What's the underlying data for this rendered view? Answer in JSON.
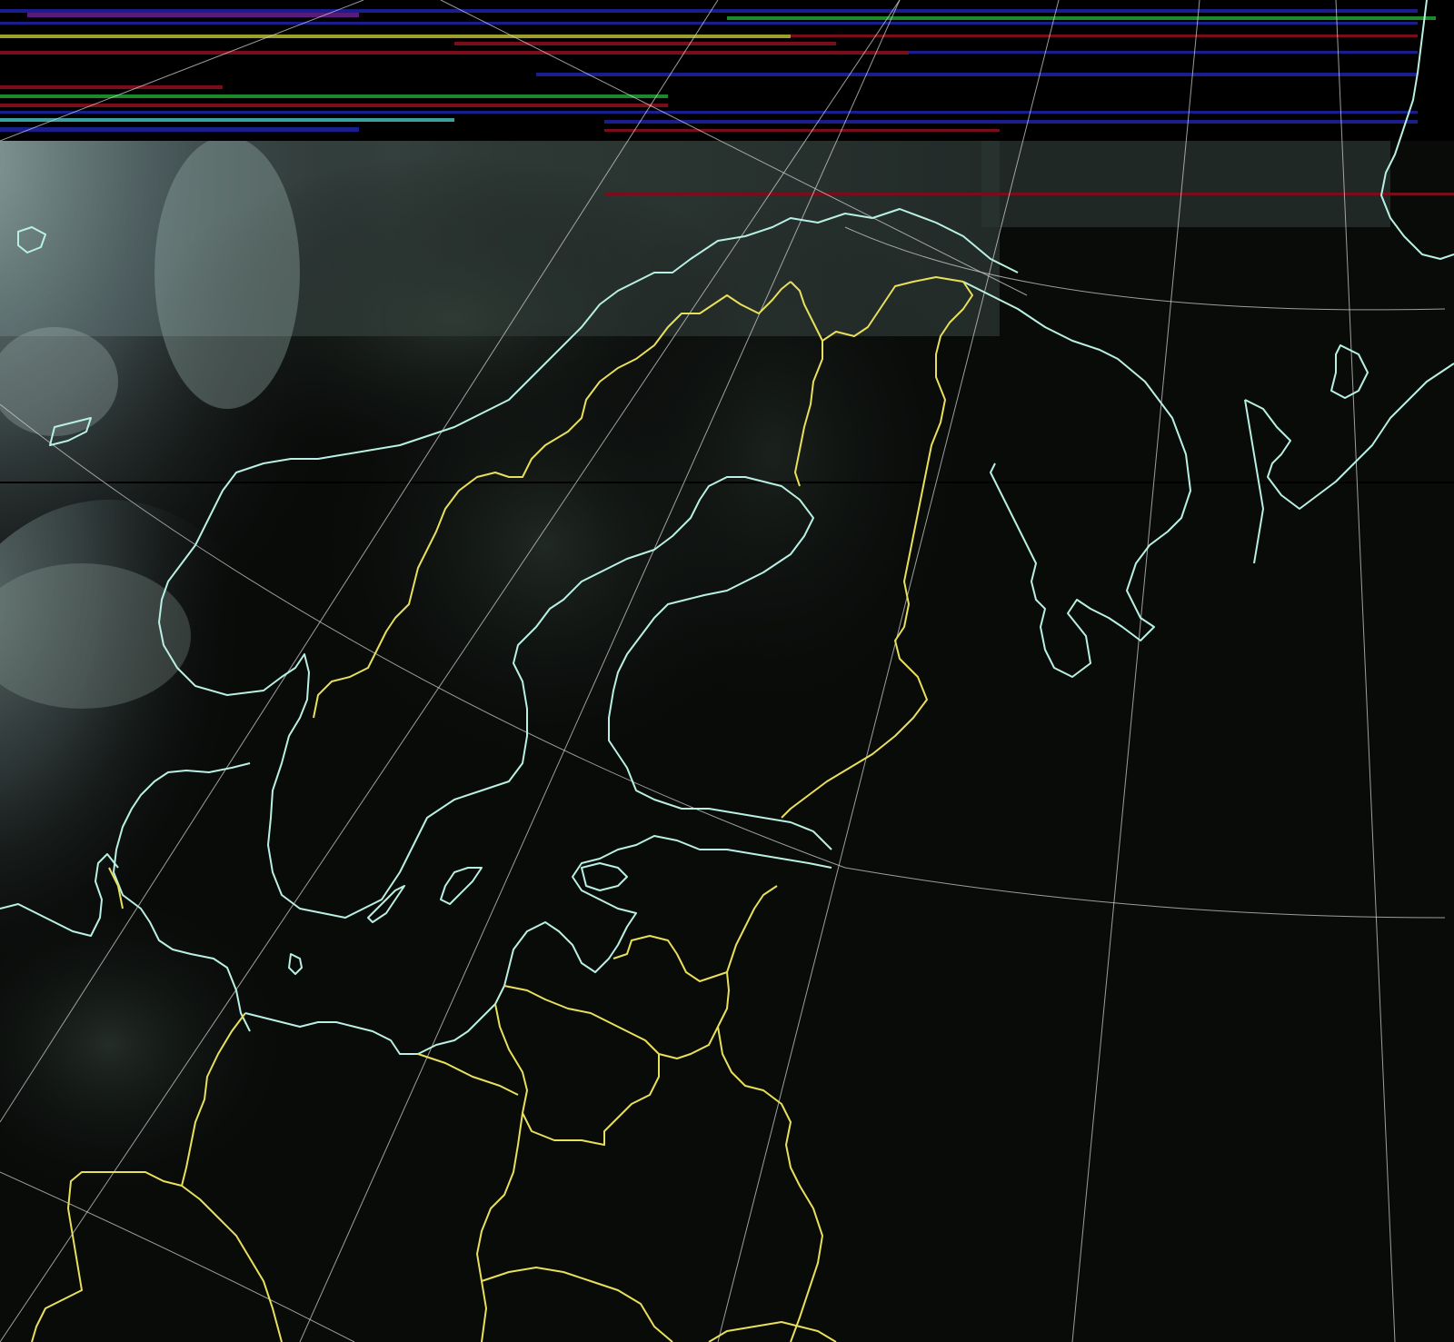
{
  "colors": {
    "background": "#090b09",
    "coastline": "#b9f0e4",
    "border": "#e8e05a",
    "graticule": "#cfcfcf",
    "noise_blue": "#1a1d8c",
    "noise_red": "#7a0d1a",
    "noise_green": "#1b8a2a",
    "noise_yellow": "#9aa02a",
    "noise_cyan": "#3aa0a0"
  },
  "layers": [
    "satellite-clouds",
    "coastlines",
    "country-borders",
    "graticule",
    "signal-noise-scanlines"
  ]
}
